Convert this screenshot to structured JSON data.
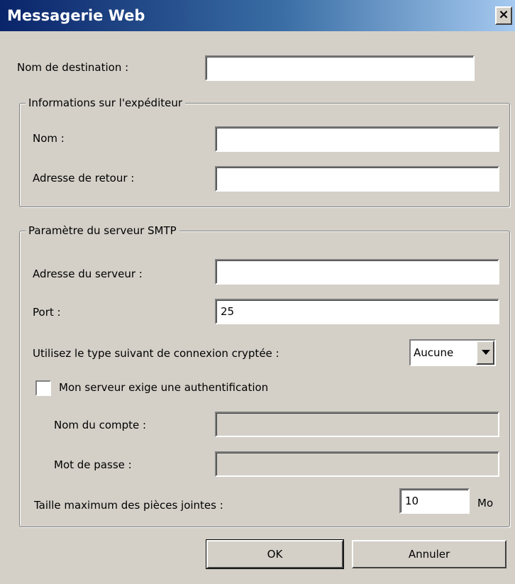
{
  "window": {
    "title": "Messagerie Web",
    "close_glyph": "×"
  },
  "destination": {
    "label": "Nom de destination :",
    "value": ""
  },
  "sender": {
    "group_title": "Informations sur l'expéditeur",
    "name_label": "Nom :",
    "name_value": "",
    "return_label": "Adresse de retour :",
    "return_value": ""
  },
  "smtp": {
    "group_title": "Paramètre du serveur SMTP",
    "server_label": "Adresse du serveur :",
    "server_value": "",
    "port_label": "Port :",
    "port_value": "25",
    "encryption_label": "Utilisez le type suivant de connexion cryptée :",
    "encryption_value": "Aucune",
    "auth_label": "Mon serveur exige une authentification",
    "auth_checked": false,
    "account_label": "Nom du compte :",
    "account_value": "",
    "password_label": "Mot de passe :",
    "password_value": "",
    "attachment_label": "Taille maximum des pièces jointes :",
    "attachment_value": "10",
    "attachment_unit": "Mo"
  },
  "buttons": {
    "ok": "OK",
    "cancel": "Annuler"
  }
}
